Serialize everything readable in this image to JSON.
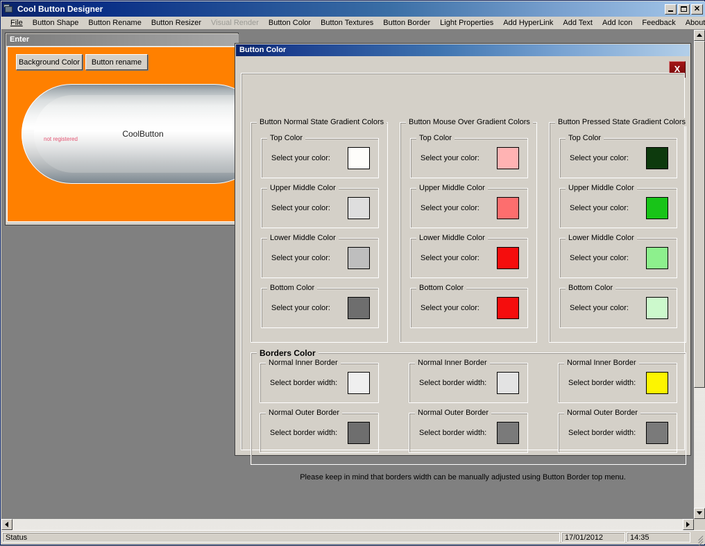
{
  "window": {
    "title": "Cool Button Designer",
    "icon": "app-window-icon",
    "controls": {
      "minimize": "_",
      "maximize": "□",
      "close": "×"
    }
  },
  "menu": [
    {
      "label": "File",
      "disabled": false
    },
    {
      "label": "Button Shape",
      "disabled": false
    },
    {
      "label": "Button Rename",
      "disabled": false
    },
    {
      "label": "Button Resizer",
      "disabled": false
    },
    {
      "label": "Visual Render",
      "disabled": true
    },
    {
      "label": "Button Color",
      "disabled": false
    },
    {
      "label": "Button Textures",
      "disabled": false
    },
    {
      "label": "Button Border",
      "disabled": false
    },
    {
      "label": "Light Properties",
      "disabled": false
    },
    {
      "label": "Add HyperLink",
      "disabled": false
    },
    {
      "label": "Add Text",
      "disabled": false
    },
    {
      "label": "Add Icon",
      "disabled": false
    },
    {
      "label": "Feedback",
      "disabled": false
    },
    {
      "label": "About",
      "disabled": false
    }
  ],
  "preview_window": {
    "title": "Enter",
    "background_color": "#ff8000",
    "buttons": {
      "background_color": "Background Color",
      "button_rename": "Button rename"
    },
    "cool_button_label": "CoolButton",
    "watermark": "not registered"
  },
  "dialog": {
    "title": "Button Color",
    "close_label": "X",
    "footnote": "Please keep in mind that borders width can be manually adjusted using Button Border top menu.",
    "select_color_label": "Select your color:",
    "select_border_width_label": "Select border width:",
    "columns": [
      {
        "title": "Button  Normal State Gradient Colors",
        "stops": [
          {
            "label": "Top Color",
            "color": "#fefdfa"
          },
          {
            "label": "Upper Middle Color",
            "color": "#dedede"
          },
          {
            "label": "Lower Middle Color",
            "color": "#bebebe"
          },
          {
            "label": "Bottom Color",
            "color": "#6e6e6e"
          }
        ]
      },
      {
        "title": "Button  Mouse Over Gradient Colors",
        "stops": [
          {
            "label": "Top Color",
            "color": "#ffb3b3"
          },
          {
            "label": "Upper Middle Color",
            "color": "#fd6e6e"
          },
          {
            "label": "Lower Middle Color",
            "color": "#f50d0d"
          },
          {
            "label": "Bottom Color",
            "color": "#f50d0d"
          }
        ]
      },
      {
        "title": "Button  Pressed State Gradient Colors",
        "stops": [
          {
            "label": "Top Color",
            "color": "#0d3a0d"
          },
          {
            "label": "Upper Middle Color",
            "color": "#18c418"
          },
          {
            "label": "Lower Middle Color",
            "color": "#8df08d"
          },
          {
            "label": "Bottom Color",
            "color": "#ccf9cc"
          }
        ]
      }
    ],
    "borders": {
      "title": "Borders Color",
      "columns": [
        {
          "items": [
            {
              "label": "Normal Inner Border",
              "color": "#efefef"
            },
            {
              "label": "Normal Outer Border",
              "color": "#6e6e6e"
            }
          ]
        },
        {
          "items": [
            {
              "label": "Normal Inner Border",
              "color": "#e3e3e3"
            },
            {
              "label": "Normal Outer Border",
              "color": "#7a7a7a"
            }
          ]
        },
        {
          "items": [
            {
              "label": "Normal Inner Border",
              "color": "#fdf500"
            },
            {
              "label": "Normal Outer Border",
              "color": "#7a7a7a"
            }
          ]
        }
      ]
    }
  },
  "status_bar": {
    "message": "Status",
    "date": "17/01/2012",
    "time": "14:35"
  }
}
